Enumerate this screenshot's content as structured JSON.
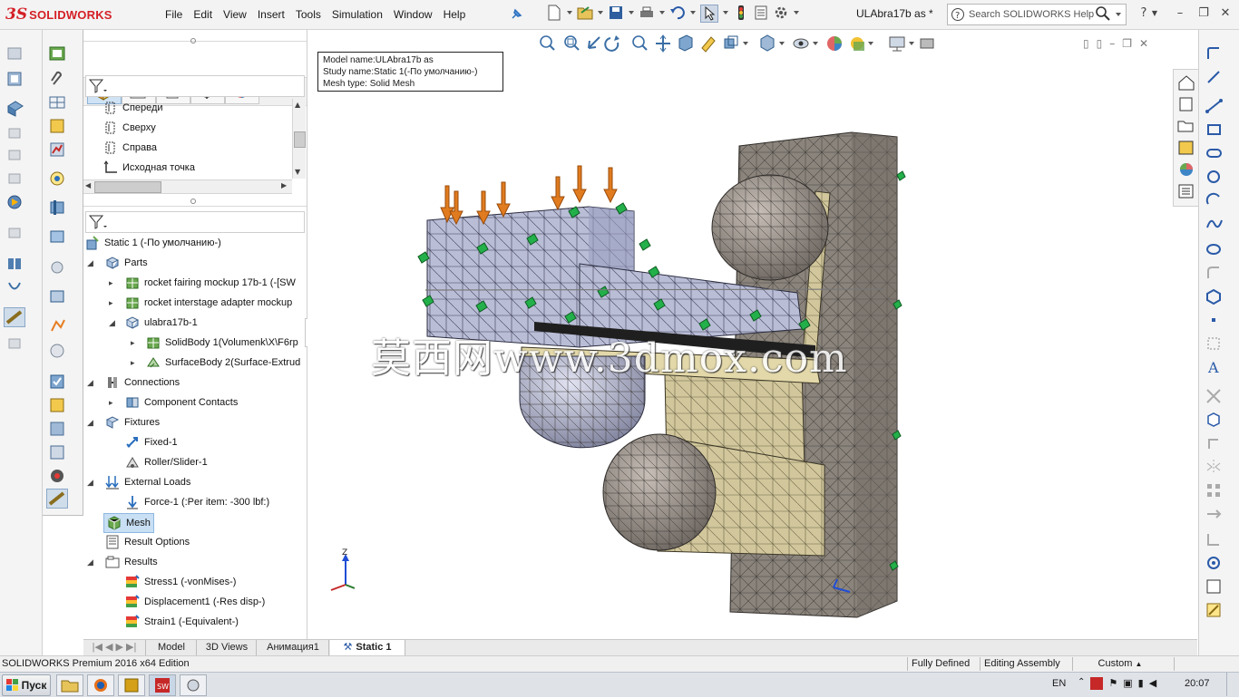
{
  "app": {
    "logo_ds": "3S",
    "logo_text": "SOLIDWORKS",
    "document_title": "ULAbra17b as *",
    "search_placeholder": "Search SOLIDWORKS Help",
    "brand_color": "#d41f26"
  },
  "menu": [
    "File",
    "Edit",
    "View",
    "Insert",
    "Tools",
    "Simulation",
    "Window",
    "Help"
  ],
  "reference_tree": [
    {
      "label": "Спереди",
      "icon": "plane-icon"
    },
    {
      "label": "Сверху",
      "icon": "plane-icon"
    },
    {
      "label": "Справа",
      "icon": "plane-icon"
    },
    {
      "label": "Исходная точка",
      "icon": "origin-icon"
    }
  ],
  "study_tree": {
    "root": "Static 1 (-По умолчанию-)",
    "parts_label": "Parts",
    "parts": [
      "rocket fairing mockup 17b-1 (-[SW",
      "rocket interstage adapter mockup",
      "ulabra17b-1"
    ],
    "bodies": [
      "SolidBody 1(Volumenk\\X\\F6rp",
      "SurfaceBody 2(Surface-Extrud"
    ],
    "connections_label": "Connections",
    "component_contacts": "Component Contacts",
    "fixtures_label": "Fixtures",
    "fixtures": [
      "Fixed-1",
      "Roller/Slider-1"
    ],
    "loads_label": "External Loads",
    "loads": [
      "Force-1 (:Per item: -300 lbf:)"
    ],
    "mesh_label": "Mesh",
    "result_options": "Result Options",
    "results_label": "Results",
    "results": [
      "Stress1 (-vonMises-)",
      "Displacement1 (-Res disp-)",
      "Strain1 (-Equivalent-)"
    ]
  },
  "viewport": {
    "info_lines": [
      "Model name:ULAbra17b as",
      "Study name:Static 1(-По умолчанию-)",
      "Mesh type: Solid Mesh"
    ],
    "watermark": "莫西网www.3dmox.com",
    "triad_label": "Z"
  },
  "bottom_tabs": [
    "Model",
    "3D Views",
    "Анимация1",
    "Static 1"
  ],
  "active_tab": "Static 1",
  "status": {
    "edition": "SOLIDWORKS Premium 2016 x64 Edition",
    "defined": "Fully Defined",
    "editing": "Editing Assembly",
    "units": "Custom"
  },
  "taskbar": {
    "start_label": "Пуск",
    "lang": "EN",
    "clock": "20:07"
  }
}
